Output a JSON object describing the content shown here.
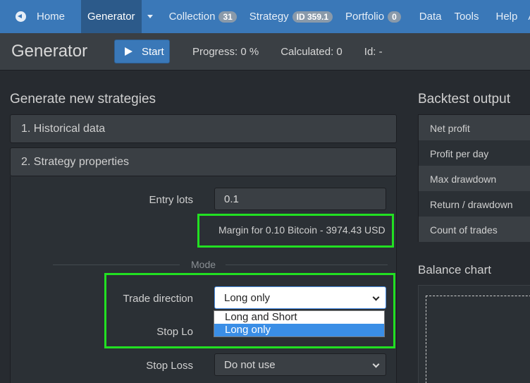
{
  "nav": {
    "home": "Home",
    "generator": "Generator",
    "collection": "Collection",
    "collection_count": "31",
    "strategy": "Strategy",
    "strategy_id": "ID 359.1",
    "portfolio": "Portfolio",
    "portfolio_count": "0",
    "data": "Data",
    "tools": "Tools",
    "help": "Help",
    "about": "About"
  },
  "header": {
    "title": "Generator",
    "start_label": "Start",
    "progress": "Progress: 0 %",
    "calculated": "Calculated: 0",
    "id": "Id: -"
  },
  "left": {
    "section_title": "Generate new strategies",
    "panel1": "1. Historical data",
    "panel2": "2. Strategy properties",
    "entry_lots_label": "Entry lots",
    "entry_lots_value": "0.1",
    "margin_text": "Margin for 0.10 Bitcoin - 3974.43 USD",
    "mode_label": "Mode",
    "trade_direction_label": "Trade direction",
    "trade_direction_value": "Long only",
    "trade_direction_options": [
      "Long and Short",
      "Long only"
    ],
    "stop_loss_partial": "Stop Lo",
    "stop_loss_label": "Stop Loss",
    "stop_loss_value": "Do not use"
  },
  "right": {
    "backtest_title": "Backtest output",
    "metrics": [
      "Net profit",
      "Profit per day",
      "Max drawdown",
      "Return / drawdown",
      "Count of trades"
    ],
    "balance_title": "Balance chart"
  },
  "colors": {
    "nav_bg": "#3a78b8",
    "highlight": "#22e022",
    "page_bg": "#272b30"
  }
}
